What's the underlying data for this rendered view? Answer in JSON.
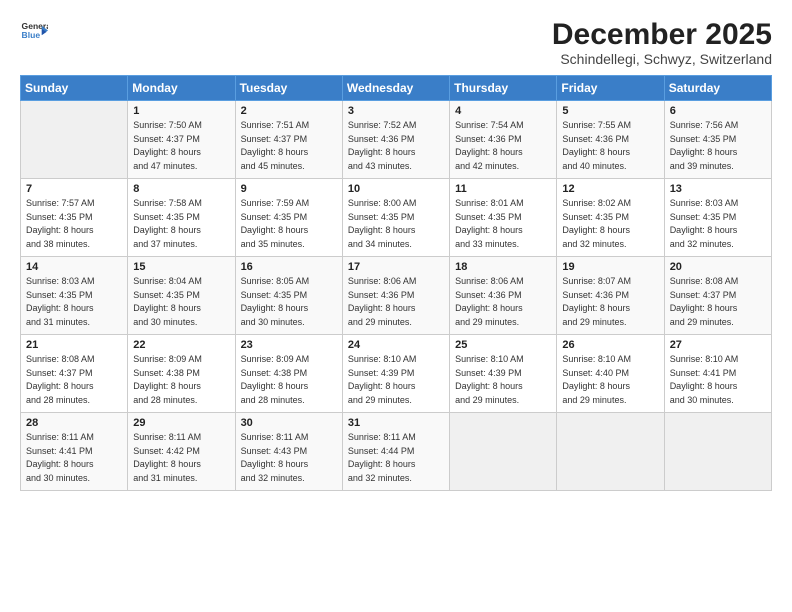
{
  "logo": {
    "line1": "General",
    "line2": "Blue"
  },
  "title": "December 2025",
  "subtitle": "Schindellegi, Schwyz, Switzerland",
  "weekdays": [
    "Sunday",
    "Monday",
    "Tuesday",
    "Wednesday",
    "Thursday",
    "Friday",
    "Saturday"
  ],
  "weeks": [
    [
      {
        "day": "",
        "sunrise": "",
        "sunset": "",
        "daylight": ""
      },
      {
        "day": "1",
        "sunrise": "Sunrise: 7:50 AM",
        "sunset": "Sunset: 4:37 PM",
        "daylight": "Daylight: 8 hours and 47 minutes."
      },
      {
        "day": "2",
        "sunrise": "Sunrise: 7:51 AM",
        "sunset": "Sunset: 4:37 PM",
        "daylight": "Daylight: 8 hours and 45 minutes."
      },
      {
        "day": "3",
        "sunrise": "Sunrise: 7:52 AM",
        "sunset": "Sunset: 4:36 PM",
        "daylight": "Daylight: 8 hours and 43 minutes."
      },
      {
        "day": "4",
        "sunrise": "Sunrise: 7:54 AM",
        "sunset": "Sunset: 4:36 PM",
        "daylight": "Daylight: 8 hours and 42 minutes."
      },
      {
        "day": "5",
        "sunrise": "Sunrise: 7:55 AM",
        "sunset": "Sunset: 4:36 PM",
        "daylight": "Daylight: 8 hours and 40 minutes."
      },
      {
        "day": "6",
        "sunrise": "Sunrise: 7:56 AM",
        "sunset": "Sunset: 4:35 PM",
        "daylight": "Daylight: 8 hours and 39 minutes."
      }
    ],
    [
      {
        "day": "7",
        "sunrise": "Sunrise: 7:57 AM",
        "sunset": "Sunset: 4:35 PM",
        "daylight": "Daylight: 8 hours and 38 minutes."
      },
      {
        "day": "8",
        "sunrise": "Sunrise: 7:58 AM",
        "sunset": "Sunset: 4:35 PM",
        "daylight": "Daylight: 8 hours and 37 minutes."
      },
      {
        "day": "9",
        "sunrise": "Sunrise: 7:59 AM",
        "sunset": "Sunset: 4:35 PM",
        "daylight": "Daylight: 8 hours and 35 minutes."
      },
      {
        "day": "10",
        "sunrise": "Sunrise: 8:00 AM",
        "sunset": "Sunset: 4:35 PM",
        "daylight": "Daylight: 8 hours and 34 minutes."
      },
      {
        "day": "11",
        "sunrise": "Sunrise: 8:01 AM",
        "sunset": "Sunset: 4:35 PM",
        "daylight": "Daylight: 8 hours and 33 minutes."
      },
      {
        "day": "12",
        "sunrise": "Sunrise: 8:02 AM",
        "sunset": "Sunset: 4:35 PM",
        "daylight": "Daylight: 8 hours and 32 minutes."
      },
      {
        "day": "13",
        "sunrise": "Sunrise: 8:03 AM",
        "sunset": "Sunset: 4:35 PM",
        "daylight": "Daylight: 8 hours and 32 minutes."
      }
    ],
    [
      {
        "day": "14",
        "sunrise": "Sunrise: 8:03 AM",
        "sunset": "Sunset: 4:35 PM",
        "daylight": "Daylight: 8 hours and 31 minutes."
      },
      {
        "day": "15",
        "sunrise": "Sunrise: 8:04 AM",
        "sunset": "Sunset: 4:35 PM",
        "daylight": "Daylight: 8 hours and 30 minutes."
      },
      {
        "day": "16",
        "sunrise": "Sunrise: 8:05 AM",
        "sunset": "Sunset: 4:35 PM",
        "daylight": "Daylight: 8 hours and 30 minutes."
      },
      {
        "day": "17",
        "sunrise": "Sunrise: 8:06 AM",
        "sunset": "Sunset: 4:36 PM",
        "daylight": "Daylight: 8 hours and 29 minutes."
      },
      {
        "day": "18",
        "sunrise": "Sunrise: 8:06 AM",
        "sunset": "Sunset: 4:36 PM",
        "daylight": "Daylight: 8 hours and 29 minutes."
      },
      {
        "day": "19",
        "sunrise": "Sunrise: 8:07 AM",
        "sunset": "Sunset: 4:36 PM",
        "daylight": "Daylight: 8 hours and 29 minutes."
      },
      {
        "day": "20",
        "sunrise": "Sunrise: 8:08 AM",
        "sunset": "Sunset: 4:37 PM",
        "daylight": "Daylight: 8 hours and 29 minutes."
      }
    ],
    [
      {
        "day": "21",
        "sunrise": "Sunrise: 8:08 AM",
        "sunset": "Sunset: 4:37 PM",
        "daylight": "Daylight: 8 hours and 28 minutes."
      },
      {
        "day": "22",
        "sunrise": "Sunrise: 8:09 AM",
        "sunset": "Sunset: 4:38 PM",
        "daylight": "Daylight: 8 hours and 28 minutes."
      },
      {
        "day": "23",
        "sunrise": "Sunrise: 8:09 AM",
        "sunset": "Sunset: 4:38 PM",
        "daylight": "Daylight: 8 hours and 28 minutes."
      },
      {
        "day": "24",
        "sunrise": "Sunrise: 8:10 AM",
        "sunset": "Sunset: 4:39 PM",
        "daylight": "Daylight: 8 hours and 29 minutes."
      },
      {
        "day": "25",
        "sunrise": "Sunrise: 8:10 AM",
        "sunset": "Sunset: 4:39 PM",
        "daylight": "Daylight: 8 hours and 29 minutes."
      },
      {
        "day": "26",
        "sunrise": "Sunrise: 8:10 AM",
        "sunset": "Sunset: 4:40 PM",
        "daylight": "Daylight: 8 hours and 29 minutes."
      },
      {
        "day": "27",
        "sunrise": "Sunrise: 8:10 AM",
        "sunset": "Sunset: 4:41 PM",
        "daylight": "Daylight: 8 hours and 30 minutes."
      }
    ],
    [
      {
        "day": "28",
        "sunrise": "Sunrise: 8:11 AM",
        "sunset": "Sunset: 4:41 PM",
        "daylight": "Daylight: 8 hours and 30 minutes."
      },
      {
        "day": "29",
        "sunrise": "Sunrise: 8:11 AM",
        "sunset": "Sunset: 4:42 PM",
        "daylight": "Daylight: 8 hours and 31 minutes."
      },
      {
        "day": "30",
        "sunrise": "Sunrise: 8:11 AM",
        "sunset": "Sunset: 4:43 PM",
        "daylight": "Daylight: 8 hours and 32 minutes."
      },
      {
        "day": "31",
        "sunrise": "Sunrise: 8:11 AM",
        "sunset": "Sunset: 4:44 PM",
        "daylight": "Daylight: 8 hours and 32 minutes."
      },
      {
        "day": "",
        "sunrise": "",
        "sunset": "",
        "daylight": ""
      },
      {
        "day": "",
        "sunrise": "",
        "sunset": "",
        "daylight": ""
      },
      {
        "day": "",
        "sunrise": "",
        "sunset": "",
        "daylight": ""
      }
    ]
  ]
}
